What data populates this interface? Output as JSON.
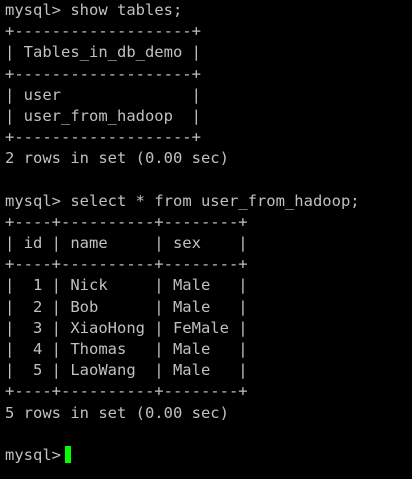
{
  "terminal": {
    "prompt": "mysql>",
    "lines": [
      {
        "kind": "cmd",
        "text": "show tables;"
      },
      {
        "kind": "out",
        "text": "+-------------------+"
      },
      {
        "kind": "out",
        "text": "| Tables_in_db_demo |"
      },
      {
        "kind": "out",
        "text": "+-------------------+"
      },
      {
        "kind": "out",
        "text": "| user              |"
      },
      {
        "kind": "out",
        "text": "| user_from_hadoop  |"
      },
      {
        "kind": "out",
        "text": "+-------------------+"
      },
      {
        "kind": "out",
        "text": "2 rows in set (0.00 sec)"
      },
      {
        "kind": "blank",
        "text": ""
      },
      {
        "kind": "cmd",
        "text": "select * from user_from_hadoop;"
      },
      {
        "kind": "out",
        "text": "+----+----------+--------+"
      },
      {
        "kind": "out",
        "text": "| id | name     | sex    |"
      },
      {
        "kind": "out",
        "text": "+----+----------+--------+"
      },
      {
        "kind": "out",
        "text": "|  1 | Nick     | Male   |"
      },
      {
        "kind": "out",
        "text": "|  2 | Bob      | Male   |"
      },
      {
        "kind": "out",
        "text": "|  3 | XiaoHong | FeMale |"
      },
      {
        "kind": "out",
        "text": "|  4 | Thomas   | Male   |"
      },
      {
        "kind": "out",
        "text": "|  5 | LaoWang  | Male   |"
      },
      {
        "kind": "out",
        "text": "+----+----------+--------+"
      },
      {
        "kind": "out",
        "text": "5 rows in set (0.00 sec)"
      },
      {
        "kind": "blank",
        "text": ""
      },
      {
        "kind": "prompt-only",
        "text": ""
      }
    ],
    "colors": {
      "background": "#000000",
      "text": "#c0c0c0",
      "cursor": "#00ff00"
    }
  }
}
